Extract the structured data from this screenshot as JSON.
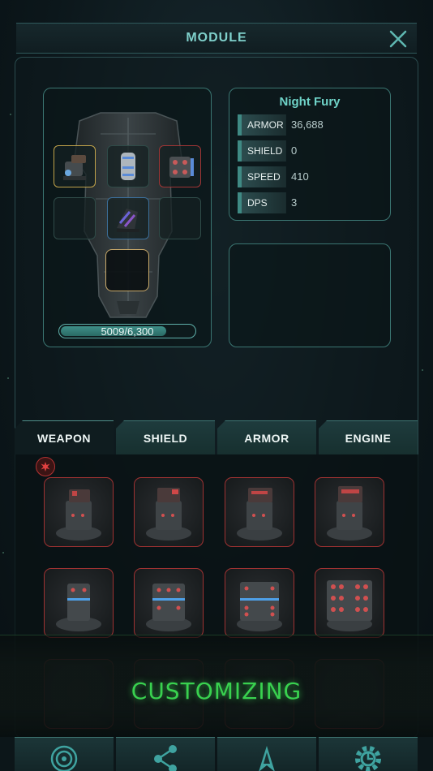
{
  "header": {
    "title": "MODULE",
    "close_icon": "close-icon"
  },
  "ship": {
    "name": "Night Fury",
    "capacity_text": "5009/6,300",
    "capacity_fraction": 0.795
  },
  "stats": [
    {
      "label": "ARMOR",
      "value": "36,688"
    },
    {
      "label": "SHIELD",
      "value": "0"
    },
    {
      "label": "SPEED",
      "value": "410"
    },
    {
      "label": "DPS",
      "value": "3"
    }
  ],
  "tabs": [
    {
      "label": "WEAPON",
      "active": true
    },
    {
      "label": "SHIELD",
      "active": false
    },
    {
      "label": "ARMOR",
      "active": false
    },
    {
      "label": "ENGINE",
      "active": false
    }
  ],
  "overlay": {
    "text": "CUSTOMIZING"
  },
  "bottom_nav": [
    "galaxy-icon",
    "share-icon",
    "ship-icon",
    "settings-gear-icon"
  ],
  "colors": {
    "accent": "#6fd3c8",
    "panel_border": "#3b7672",
    "item_border": "#a03232",
    "glow_green": "#39d14f"
  }
}
